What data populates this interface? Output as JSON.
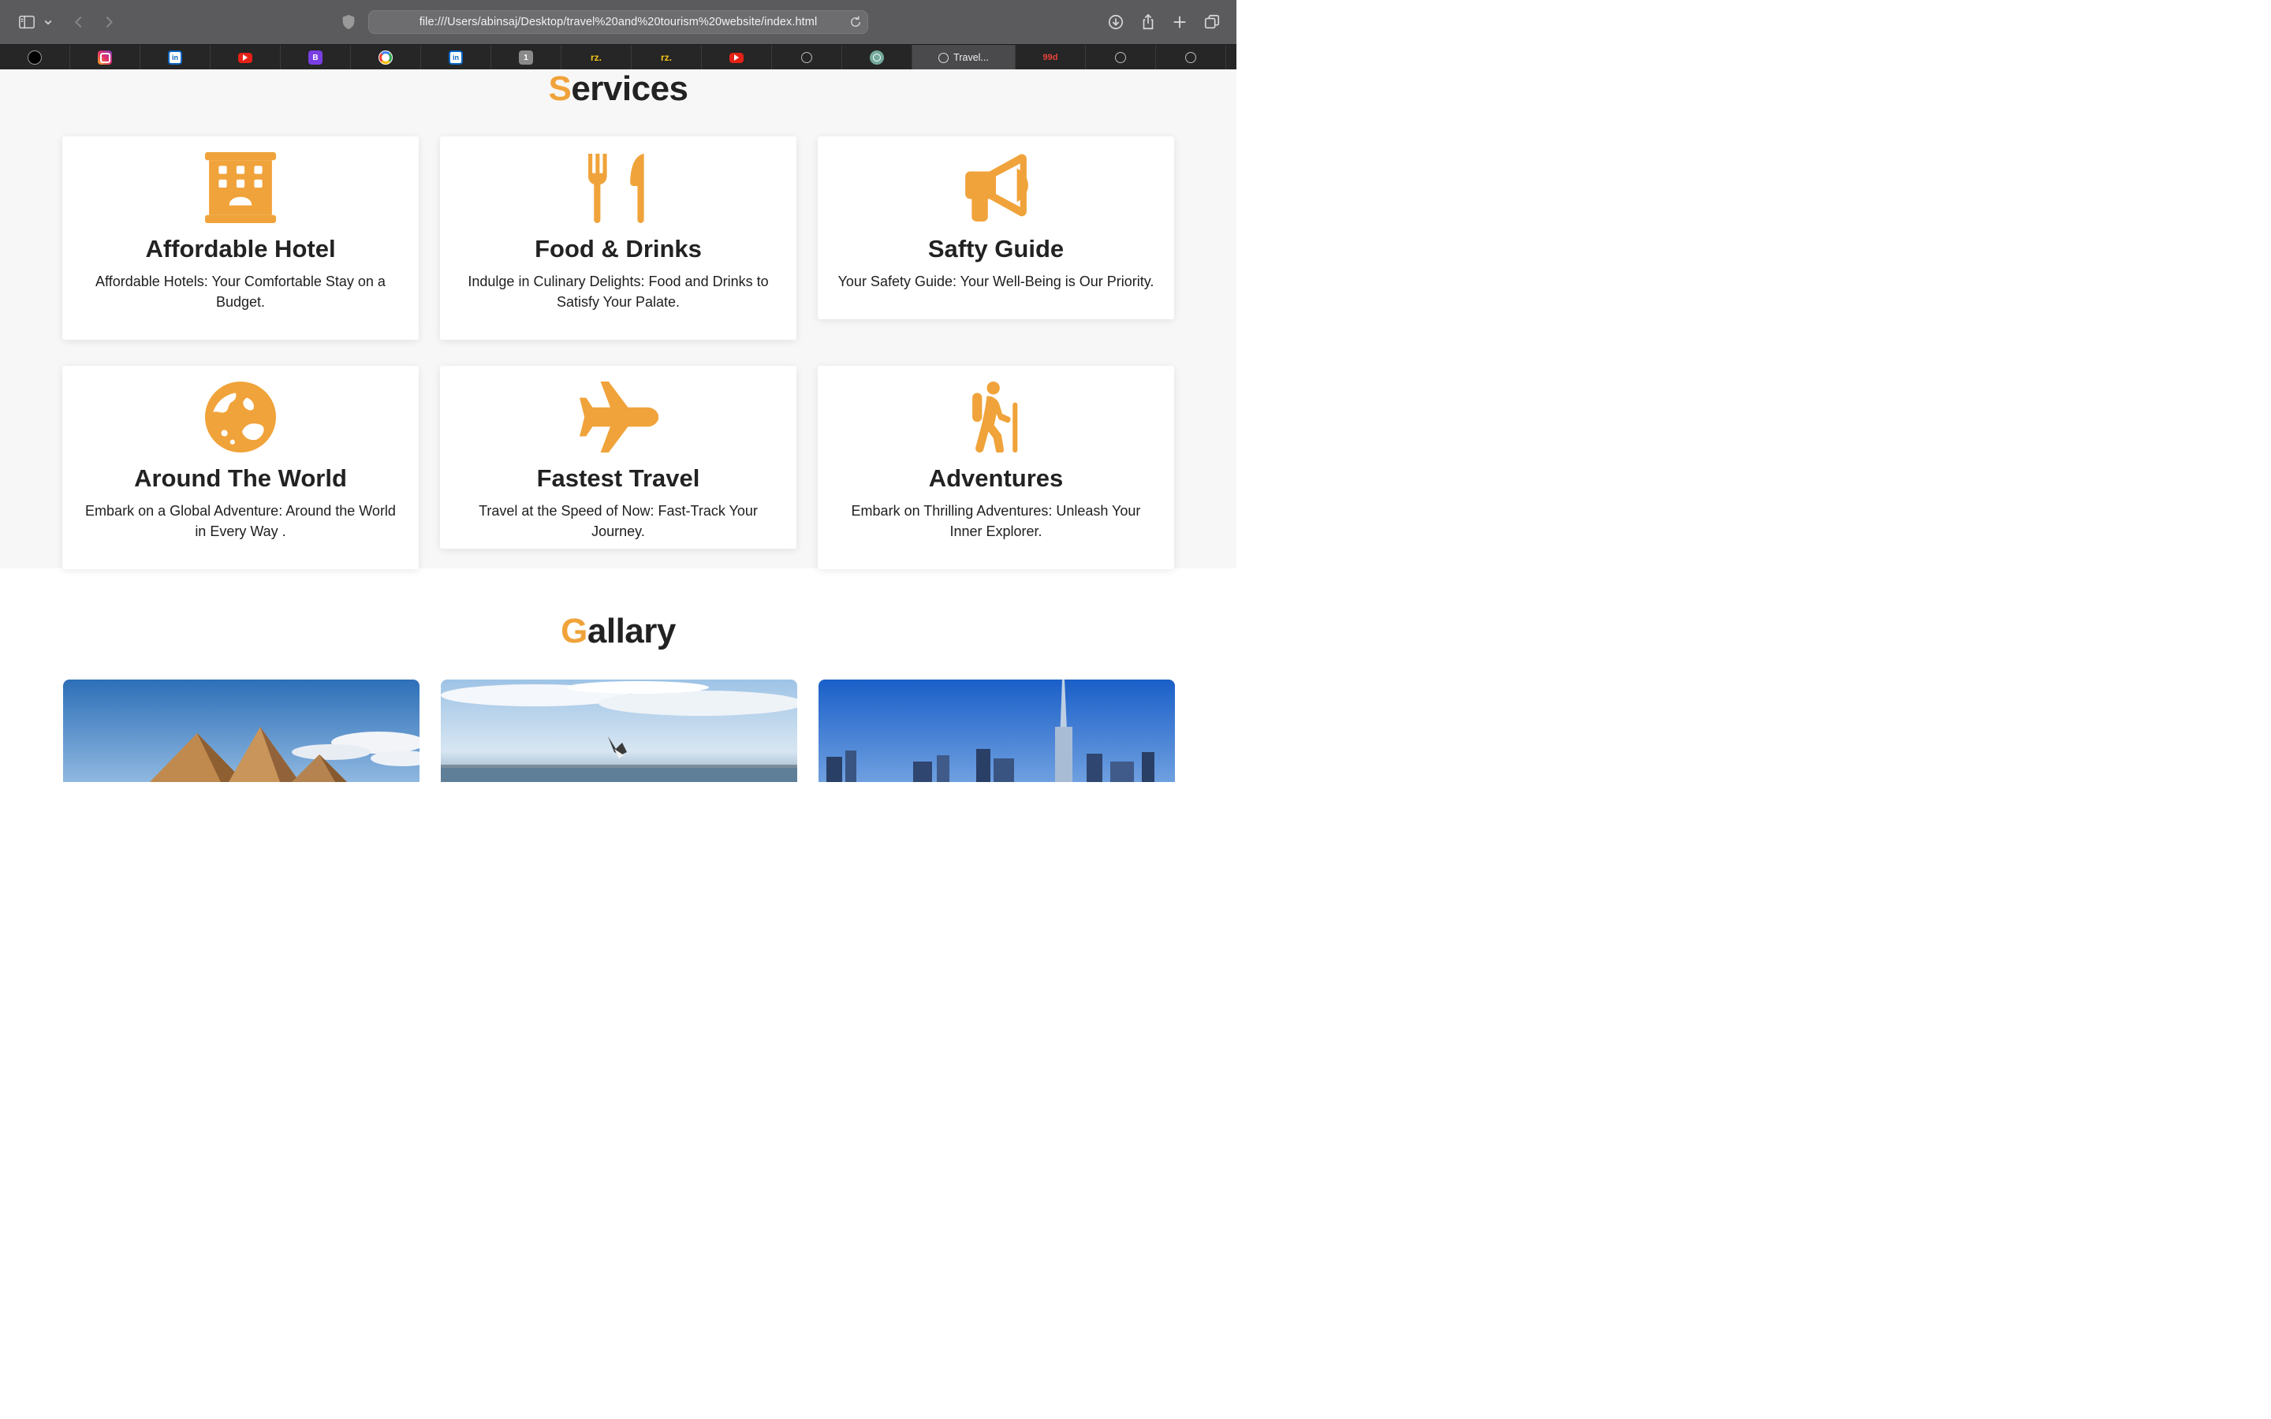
{
  "browser": {
    "url": "file:///Users/abinsaj/Desktop/travel%20and%20tourism%20website/index.html",
    "active_tab_label": "Travel...",
    "tab_favicons": [
      "site-logo",
      "instagram",
      "linkedin",
      "youtube",
      "bootstrap",
      "google",
      "linkedin",
      "1password",
      "rz.",
      "rz.",
      "youtube",
      "safari-compass",
      "chatgpt",
      "safari-compass",
      "99designs",
      "safari-compass",
      "safari-compass"
    ],
    "tab_texts": {
      "bootstrap": "B",
      "onepass": "1",
      "rz1": "rz.",
      "rz2": "rz.",
      "nn": "99d"
    }
  },
  "services": {
    "title_first": "S",
    "title_rest": "ervices",
    "cards": [
      {
        "icon": "hotel-icon",
        "title": "Affordable Hotel",
        "desc": "Affordable Hotels: Your Comfortable Stay on a Budget."
      },
      {
        "icon": "utensils-icon",
        "title": "Food & Drinks",
        "desc": "Indulge in Culinary Delights: Food and Drinks to Satisfy Your Palate."
      },
      {
        "icon": "bullhorn-icon",
        "title": "Safty Guide",
        "desc": "Your Safety Guide: Your Well-Being is Our Priority."
      },
      {
        "icon": "globe-icon",
        "title": "Around The World",
        "desc": "Embark on a Global Adventure: Around the World in Every Way ."
      },
      {
        "icon": "plane-icon",
        "title": "Fastest Travel",
        "desc": "Travel at the Speed of Now: Fast-Track Your Journey."
      },
      {
        "icon": "hiker-icon",
        "title": "Adventures",
        "desc": "Embark on Thrilling Adventures: Unleash Your Inner Explorer."
      }
    ]
  },
  "gallery": {
    "title_first": "G",
    "title_rest": "allary",
    "images": [
      "pyramids-image",
      "seagull-sea-image",
      "dubai-skyline-image"
    ]
  },
  "colors": {
    "accent": "#f0a33a",
    "heading": "#222222",
    "section_bg": "#f7f7f7"
  }
}
